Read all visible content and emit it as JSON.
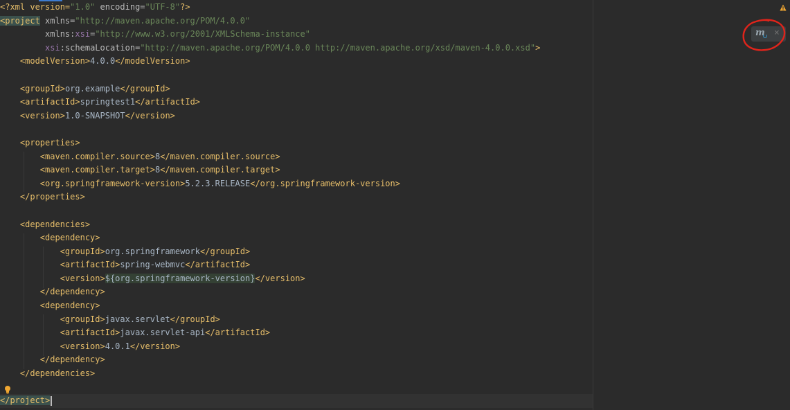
{
  "editor": {
    "file_type": "pom.xml",
    "lines": {
      "l1": {
        "decl_open": "<?xml version=",
        "v1": "\"1.0\"",
        "a2": " encoding=",
        "v2": "\"UTF-8\"",
        "decl_close": "?>"
      },
      "l2": {
        "open": "<project",
        "a1": " xmlns=",
        "v1": "\"http://maven.apache.org/POM/4.0.0\""
      },
      "l3": {
        "a1": "xmlns:",
        "ns": "xsi",
        "eq": "=",
        "v1": "\"http://www.w3.org/2001/XMLSchema-instance\""
      },
      "l4": {
        "ns": "xsi",
        "a1": ":schemaLocation=",
        "v1": "\"http://maven.apache.org/POM/4.0.0 http://maven.apache.org/xsd/maven-4.0.0.xsd\"",
        "close": ">"
      },
      "l5": {
        "open": "<modelVersion>",
        "text": "4.0.0",
        "close": "</modelVersion>"
      },
      "l7": {
        "open": "<groupId>",
        "text": "org.example",
        "close": "</groupId>"
      },
      "l8": {
        "open": "<artifactId>",
        "text": "springtest1",
        "close": "</artifactId>"
      },
      "l9": {
        "open": "<version>",
        "text": "1.0-SNAPSHOT",
        "close": "</version>"
      },
      "l11": {
        "open": "<properties>"
      },
      "l12": {
        "open": "<maven.compiler.source>",
        "text": "8",
        "close": "</maven.compiler.source>"
      },
      "l13": {
        "open": "<maven.compiler.target>",
        "text": "8",
        "close": "</maven.compiler.target>"
      },
      "l14": {
        "open": "<org.springframework-version>",
        "text": "5.2.3.RELEASE",
        "close": "</org.springframework-version>"
      },
      "l15": {
        "close": "</properties>"
      },
      "l17": {
        "open": "<dependencies>"
      },
      "l18": {
        "open": "<dependency>"
      },
      "l19": {
        "open": "<groupId>",
        "text": "org.springframework",
        "close": "</groupId>"
      },
      "l20": {
        "open": "<artifactId>",
        "text": "spring-webmvc",
        "close": "</artifactId>"
      },
      "l21": {
        "open": "<version>",
        "text": "${org.springframework-version}",
        "close": "</version>"
      },
      "l22": {
        "close": "</dependency>"
      },
      "l23": {
        "open": "<dependency>"
      },
      "l24": {
        "open": "<groupId>",
        "text": "javax.servlet",
        "close": "</groupId>"
      },
      "l25": {
        "open": "<artifactId>",
        "text": "javax.servlet-api",
        "close": "</artifactId>"
      },
      "l26": {
        "open": "<version>",
        "text": "4.0.1",
        "close": "</version>"
      },
      "l27": {
        "close": "</dependency>"
      },
      "l28": {
        "close": "</dependencies>"
      },
      "l30": {
        "close": "</project>"
      }
    }
  },
  "toolbar": {
    "maven_reload_icon": "maven-reload-icon",
    "close_icon": "close-icon",
    "warning_icon": "warning-icon",
    "maven_glyph": "m",
    "close_glyph": "×"
  },
  "colors": {
    "background": "#2b2b2b",
    "tag": "#e8bf6a",
    "attribute_value": "#6a8759",
    "namespace": "#9876aa",
    "text": "#a9b7c6",
    "annotation_circle": "#e0241b"
  }
}
